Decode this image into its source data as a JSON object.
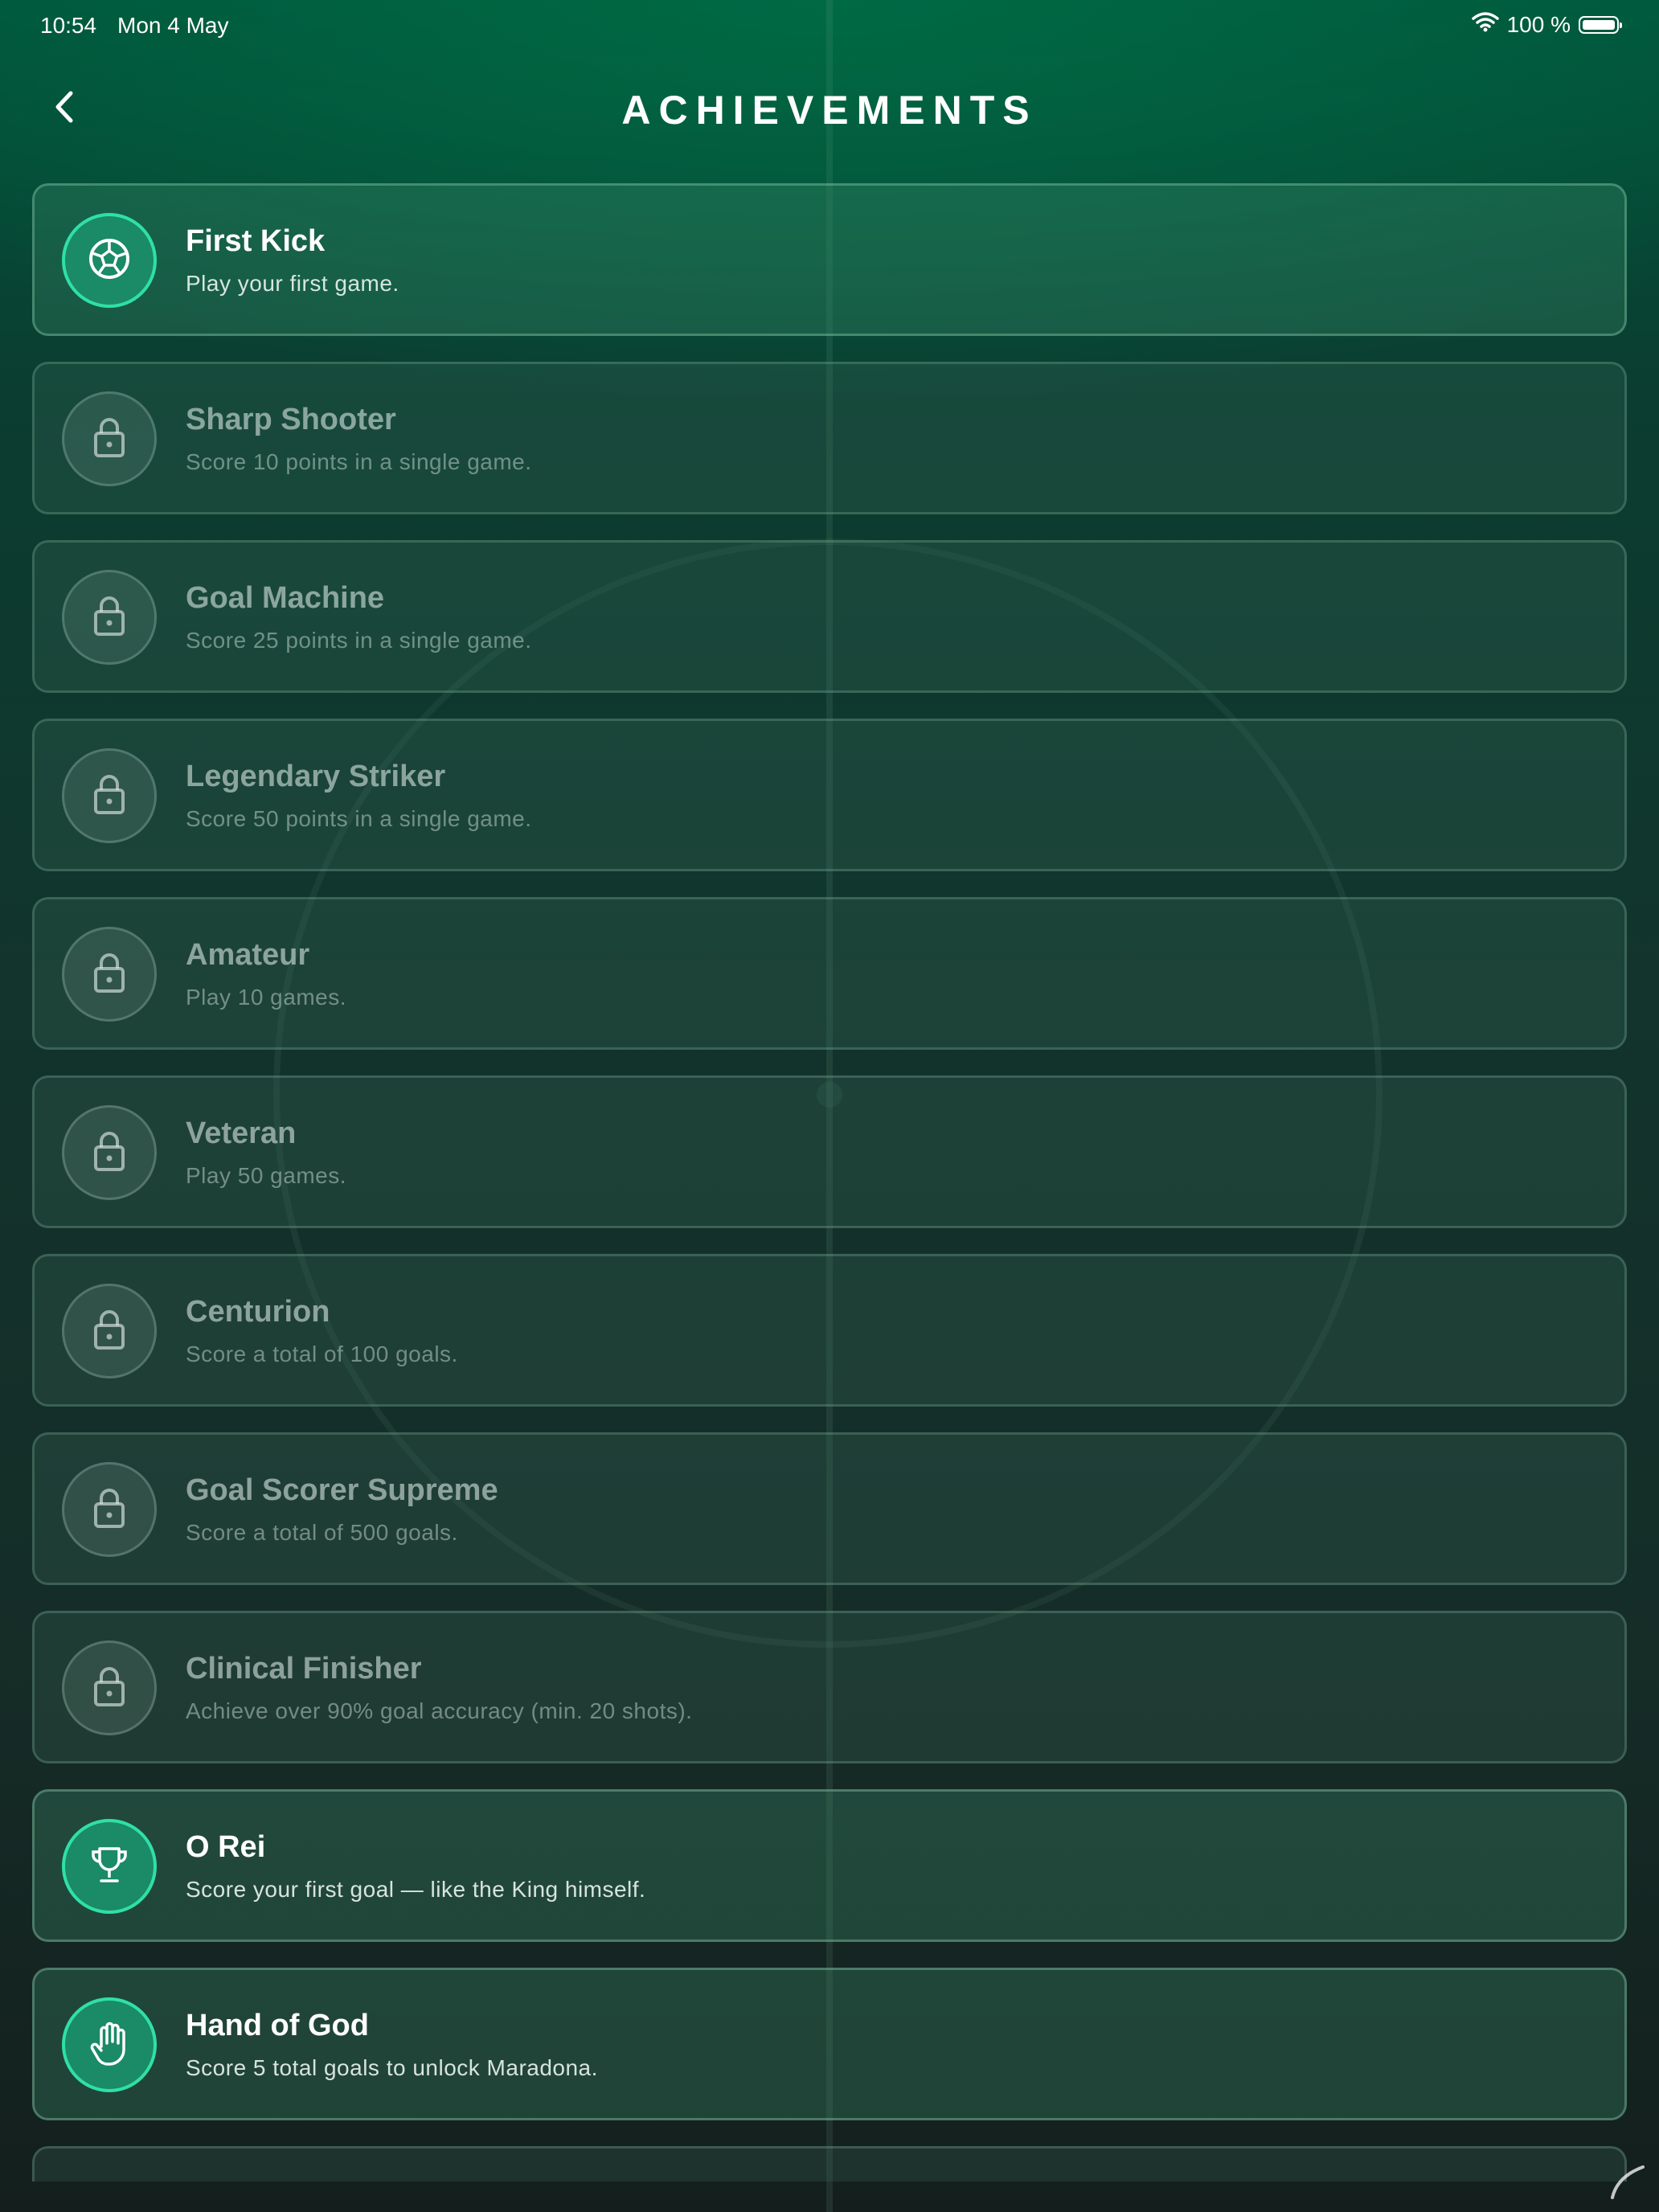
{
  "status_bar": {
    "time": "10:54",
    "date": "Mon 4 May",
    "battery": "100 %"
  },
  "header": {
    "title": "ACHIEVEMENTS",
    "back_icon": "chevron-left-icon"
  },
  "colors": {
    "accent": "#2fe0a6",
    "badge_unlocked": "#1b8a66",
    "background_top": "#00533a",
    "background_bottom": "#141f1d"
  },
  "achievements": [
    {
      "title": "First Kick",
      "description": "Play your first game.",
      "unlocked": true,
      "icon": "soccer-ball-icon"
    },
    {
      "title": "Sharp Shooter",
      "description": "Score 10 points in a single game.",
      "unlocked": false,
      "icon": "lock-icon"
    },
    {
      "title": "Goal Machine",
      "description": "Score 25 points in a single game.",
      "unlocked": false,
      "icon": "lock-icon"
    },
    {
      "title": "Legendary Striker",
      "description": "Score 50 points in a single game.",
      "unlocked": false,
      "icon": "lock-icon"
    },
    {
      "title": "Amateur",
      "description": "Play 10 games.",
      "unlocked": false,
      "icon": "lock-icon"
    },
    {
      "title": "Veteran",
      "description": "Play 50 games.",
      "unlocked": false,
      "icon": "lock-icon"
    },
    {
      "title": "Centurion",
      "description": "Score a total of 100 goals.",
      "unlocked": false,
      "icon": "lock-icon"
    },
    {
      "title": "Goal Scorer Supreme",
      "description": "Score a total of 500 goals.",
      "unlocked": false,
      "icon": "lock-icon"
    },
    {
      "title": "Clinical Finisher",
      "description": "Achieve over 90% goal accuracy (min. 20 shots).",
      "unlocked": false,
      "icon": "lock-icon"
    },
    {
      "title": "O Rei",
      "description": "Score your first goal — like the King himself.",
      "unlocked": true,
      "icon": "trophy-icon"
    },
    {
      "title": "Hand of God",
      "description": "Score 5 total goals to unlock Maradona.",
      "unlocked": true,
      "icon": "hand-icon"
    }
  ]
}
